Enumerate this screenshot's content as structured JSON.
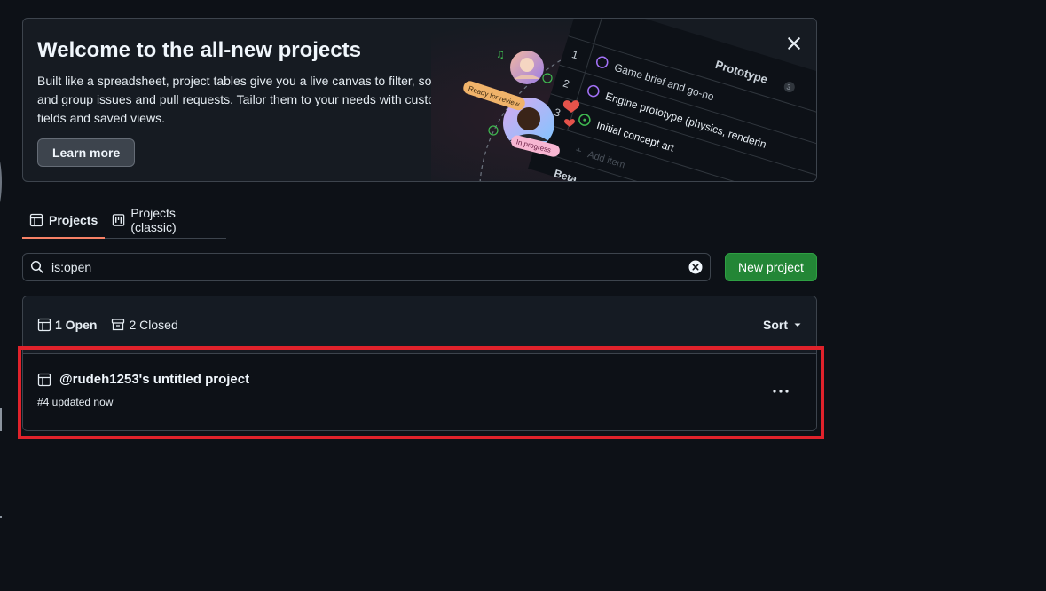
{
  "banner": {
    "title": "Welcome to the all-new projects",
    "description": "Built like a spreadsheet, project tables give you a live canvas to filter, sort, and group issues and pull requests. Tailor them to your needs with custom fields and saved views.",
    "learn_more": "Learn more",
    "illustration": {
      "header": "Prototype",
      "rows": [
        {
          "num": "1",
          "text": "Game brief and go-no"
        },
        {
          "num": "2",
          "text": "Engine prototype (physics, renderin"
        },
        {
          "num": "3",
          "text": "Initial concept art"
        }
      ],
      "add_item": "Add item",
      "next_group": "Beta",
      "badge_review": "Ready for review",
      "badge_progress": "In progress",
      "count": "3"
    }
  },
  "tabs": [
    {
      "label": "Projects",
      "icon": "table-icon",
      "active": true
    },
    {
      "label": "Projects (classic)",
      "icon": "project-board-icon",
      "active": false
    }
  ],
  "search": {
    "value": "is:open"
  },
  "new_project": "New project",
  "list": {
    "open_label": "1 Open",
    "closed_label": "2 Closed",
    "sort_label": "Sort",
    "rows": [
      {
        "title": "@rudeh1253's untitled project",
        "meta": "#4 updated now"
      }
    ]
  },
  "colors": {
    "accent_tab": "#f78166",
    "primary_button": "#238636",
    "highlight": "#e0222b"
  }
}
